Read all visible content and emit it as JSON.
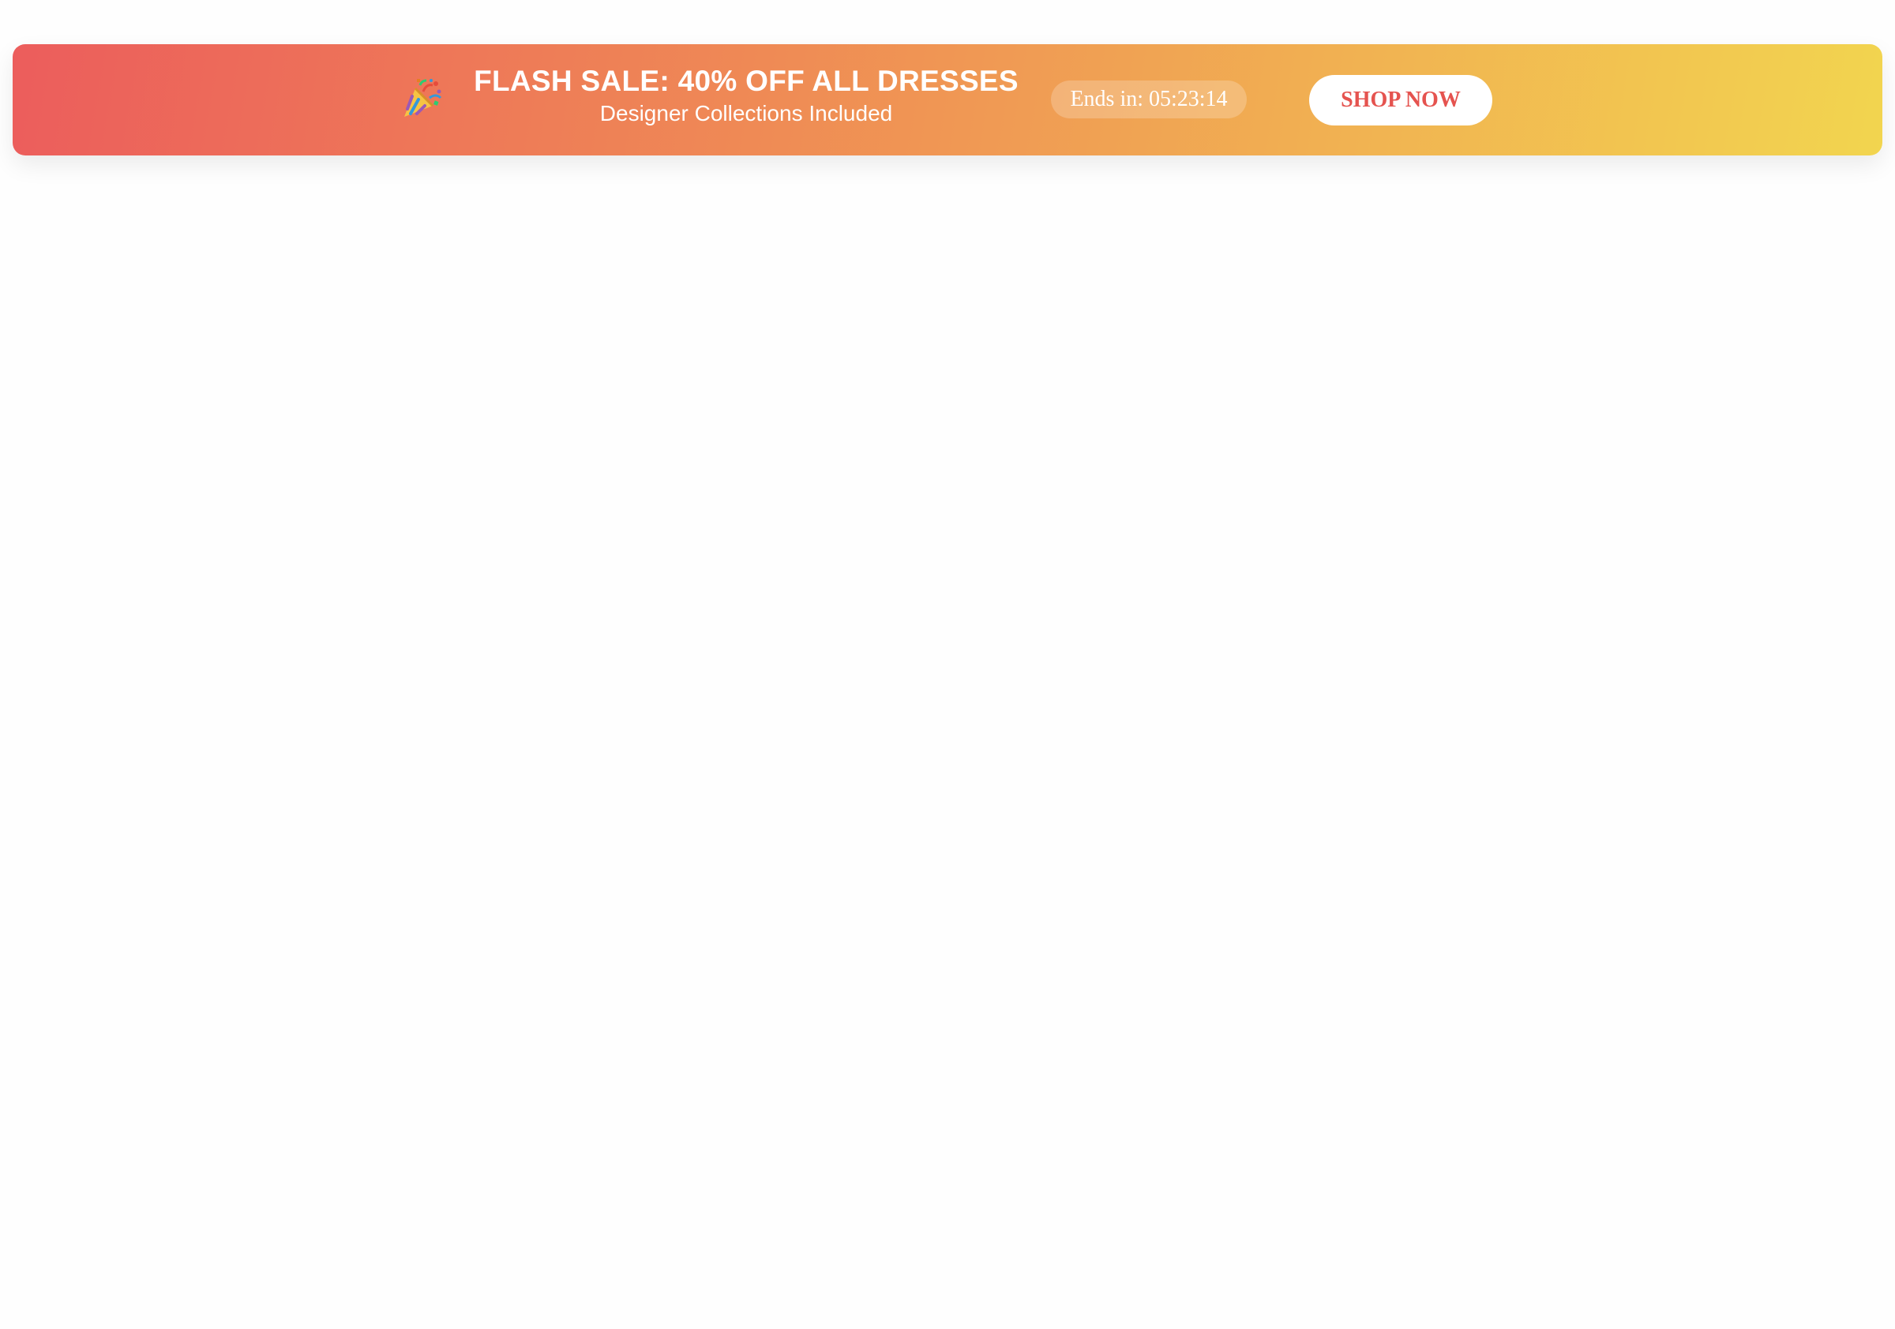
{
  "banner": {
    "icon": "party-popper-icon",
    "title": "FLASH SALE: 40% OFF ALL DRESSES",
    "subtitle": "Designer Collections Included",
    "countdown": "Ends in: 05:23:14",
    "cta_label": "SHOP NOW",
    "colors": {
      "gradient_start": "#ec5d5c",
      "gradient_end": "#f2d54f",
      "cta_text": "#e5534f"
    }
  }
}
